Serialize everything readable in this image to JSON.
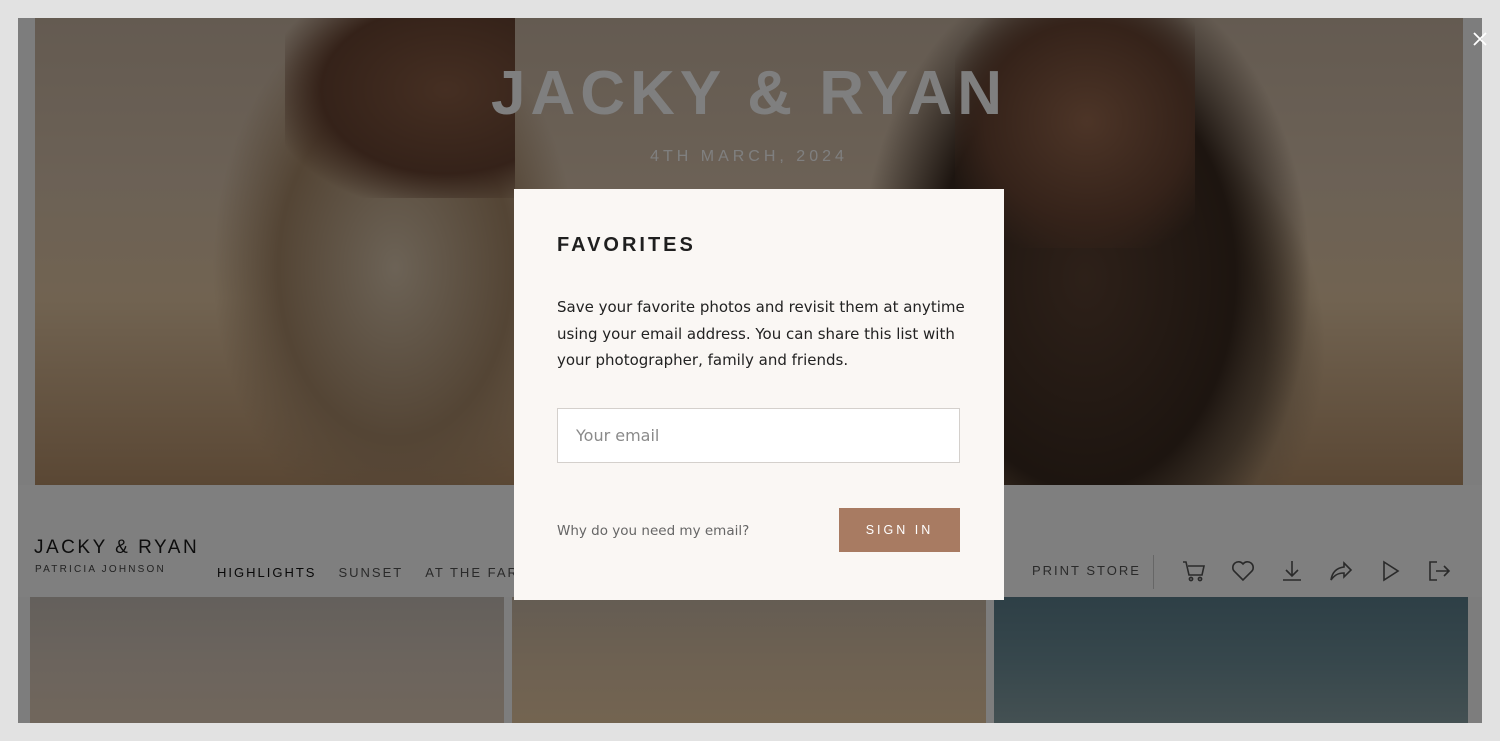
{
  "gallery": {
    "title": "JACKY & RYAN",
    "date": "4TH MARCH, 2024",
    "brand_title": "JACKY & RYAN",
    "brand_subtitle": "PATRICIA JOHNSON",
    "nav_links": [
      "HIGHLIGHTS",
      "SUNSET",
      "AT THE FARM"
    ],
    "active_link": "HIGHLIGHTS",
    "print_store": "PRINT STORE",
    "icons": [
      "cart-icon",
      "heart-icon",
      "download-icon",
      "share-icon",
      "play-icon",
      "logout-icon"
    ]
  },
  "modal": {
    "title": "FAVORITES",
    "description": "Save your favorite photos and revisit them at anytime using your email address. You can share this list with your photographer, family and friends.",
    "email_placeholder": "Your email",
    "email_value": "",
    "why_link": "Why do you need my email?",
    "sign_in_label": "SIGN IN",
    "accent_color": "#a87b62"
  }
}
